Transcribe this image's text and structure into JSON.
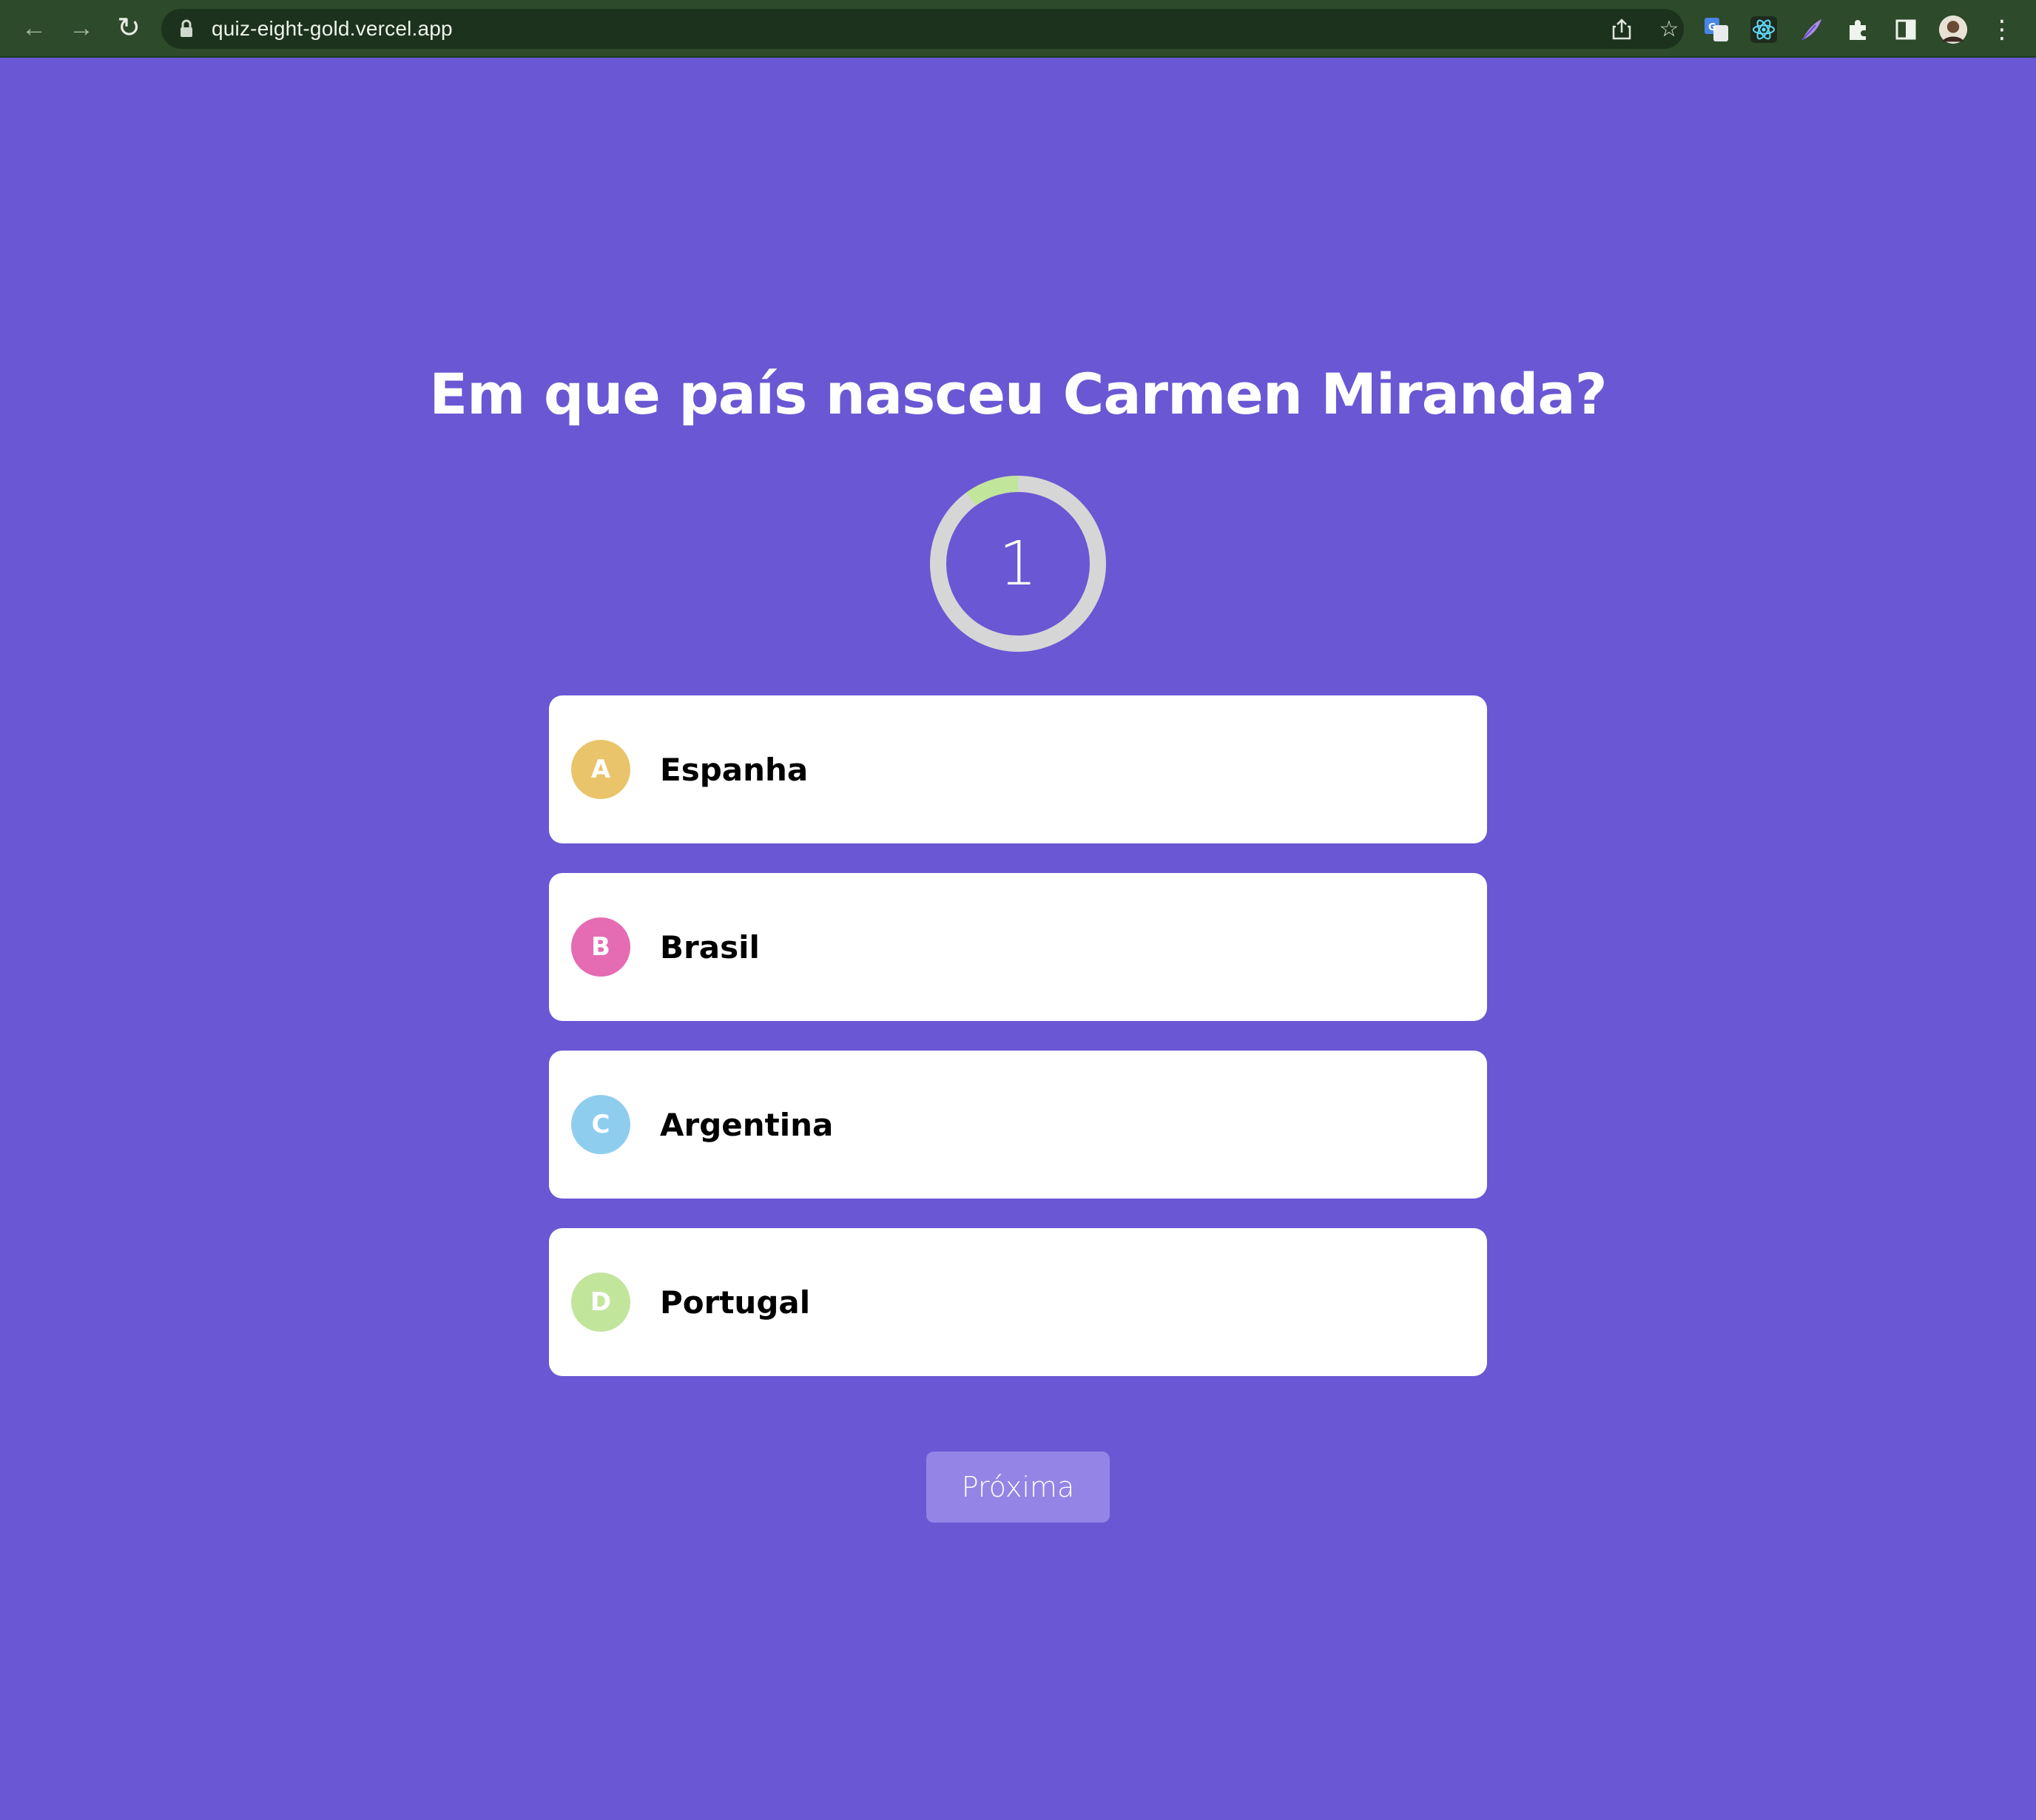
{
  "browser": {
    "url": "quiz-eight-gold.vercel.app"
  },
  "quiz": {
    "question": "Em que país nasceu Carmen Miranda?",
    "timer": {
      "value": "1",
      "progress_fraction": 0.1,
      "progress_color": "#c2e59c",
      "track_color": "#d6d6d6"
    },
    "answers": [
      {
        "letter": "A",
        "text": "Espanha",
        "color": "#e9c46a"
      },
      {
        "letter": "B",
        "text": "Brasil",
        "color": "#e56bb3"
      },
      {
        "letter": "C",
        "text": "Argentina",
        "color": "#8fcdee"
      },
      {
        "letter": "D",
        "text": "Portugal",
        "color": "#c2e59c"
      }
    ],
    "next_label": "Próxima"
  },
  "colors": {
    "background": "#6957d3",
    "browser_bar": "#2d4a2b"
  }
}
